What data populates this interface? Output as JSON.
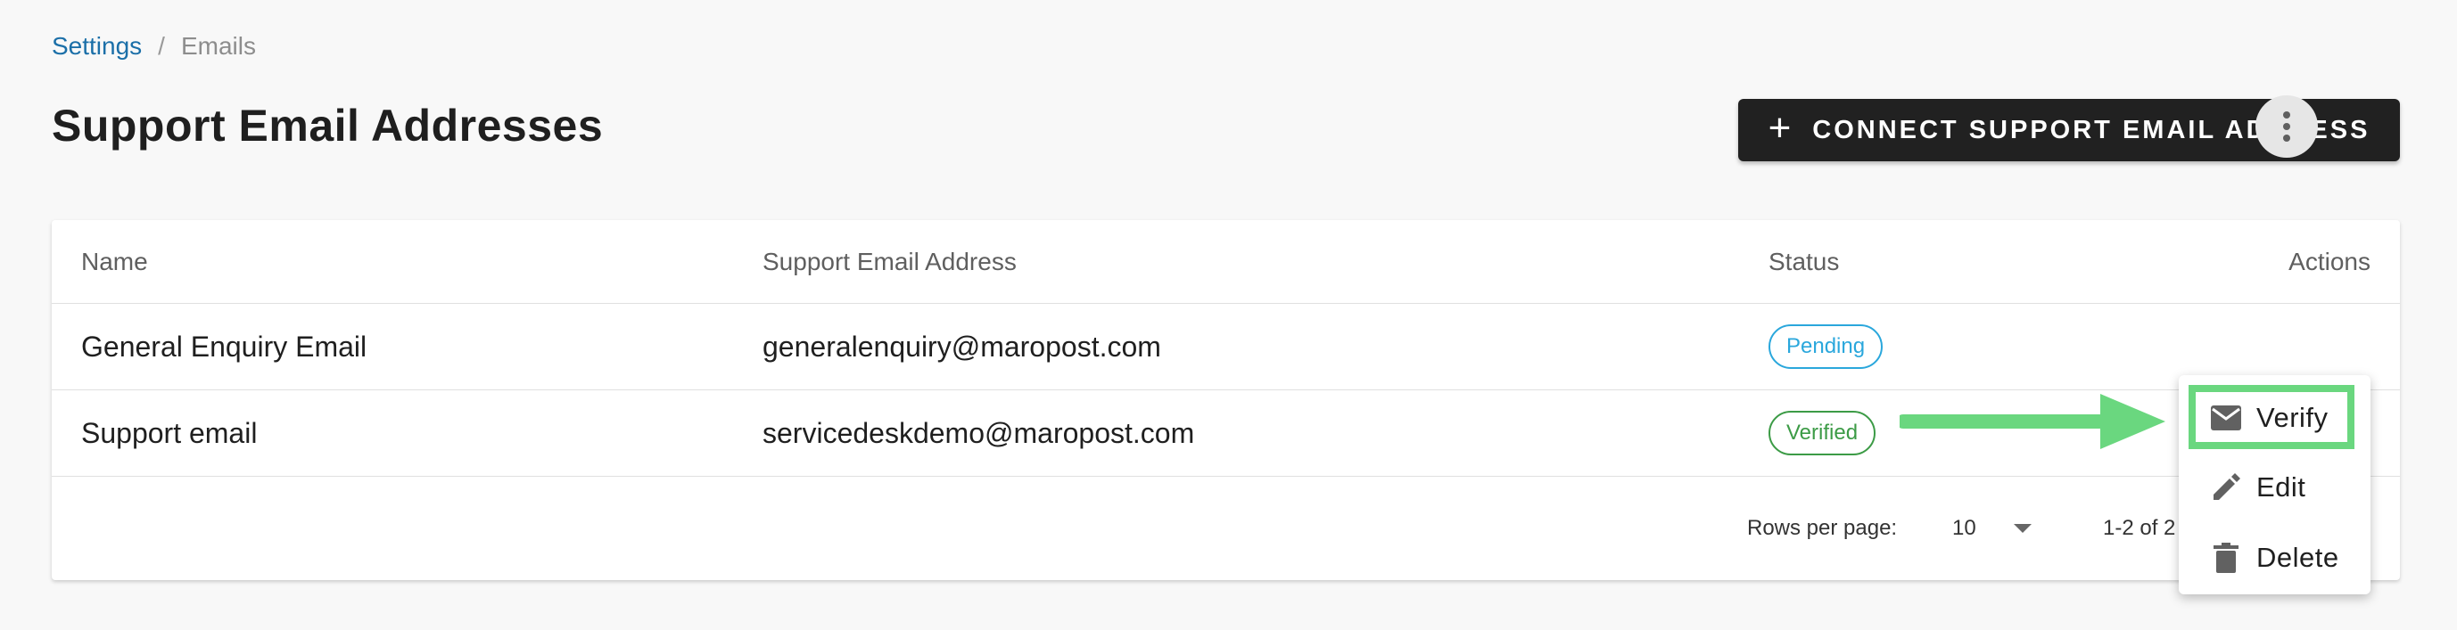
{
  "breadcrumb": {
    "parent": "Settings",
    "separator": "/",
    "current": "Emails"
  },
  "page": {
    "title": "Support Email Addresses"
  },
  "toolbar": {
    "connect_icon": "plus-icon",
    "connect_label": "CONNECT SUPPORT EMAIL ADDRESS"
  },
  "table": {
    "headers": {
      "name": "Name",
      "email": "Support Email Address",
      "status": "Status",
      "actions": "Actions"
    },
    "rows": [
      {
        "name": "General Enquiry Email",
        "email": "generalenquiry@maropost.com",
        "status": "Pending"
      },
      {
        "name": "Support email",
        "email": "servicedeskdemo@maropost.com",
        "status": "Verified"
      }
    ]
  },
  "pagination": {
    "rows_per_page_label": "Rows per page:",
    "rows_per_page_value": "10",
    "range": "1-2 of 2"
  },
  "action_menu": {
    "items": [
      {
        "label": "Verify",
        "icon": "mail-icon"
      },
      {
        "label": "Edit",
        "icon": "pencil-icon"
      },
      {
        "label": "Delete",
        "icon": "trash-icon"
      }
    ]
  },
  "colors": {
    "link": "#1b6fa8",
    "button_bg": "#212121",
    "pending": "#2aa7dc",
    "verified": "#3c9b46",
    "highlight": "#6ad77f"
  }
}
